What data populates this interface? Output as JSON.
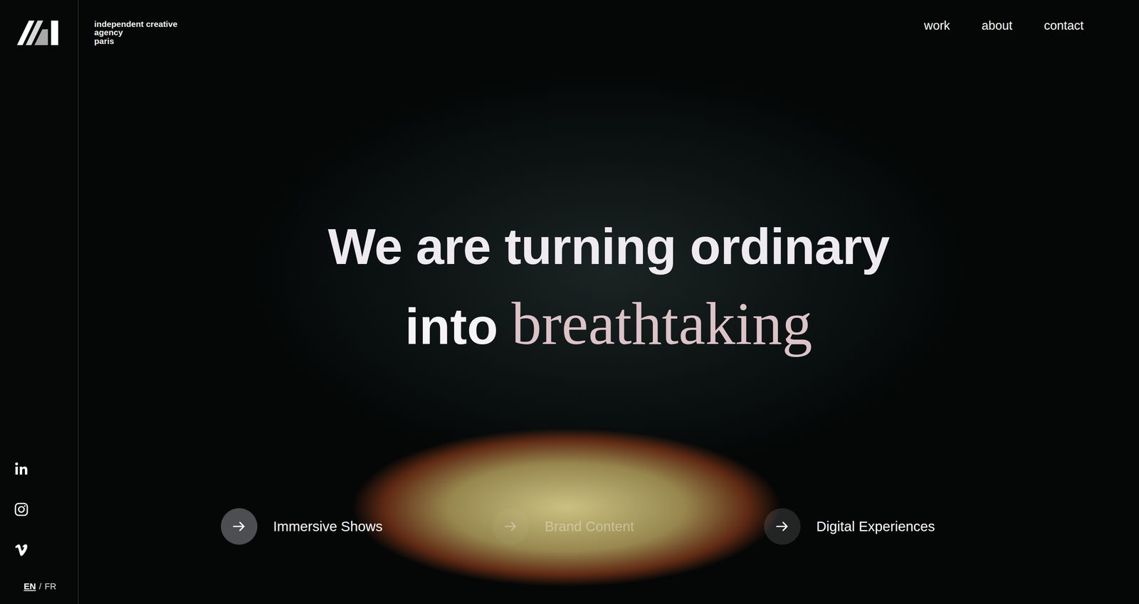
{
  "brand": {
    "tagline": [
      "independent creative",
      "agency",
      "paris"
    ]
  },
  "nav": [
    {
      "label": "work"
    },
    {
      "label": "about"
    },
    {
      "label": "contact"
    }
  ],
  "hero": {
    "line1": "We are turning ordinary",
    "line2_prefix": "into",
    "highlight": "breathtaking"
  },
  "services": [
    {
      "label": "Immersive Shows",
      "selected": true,
      "dimmed": false
    },
    {
      "label": "Brand Content",
      "selected": false,
      "dimmed": true
    },
    {
      "label": "Digital Experiences",
      "selected": false,
      "dimmed": false
    }
  ],
  "socials": [
    {
      "kind": "linkedin"
    },
    {
      "kind": "instagram"
    },
    {
      "kind": "vimeo"
    }
  ],
  "languages": [
    {
      "label": "EN",
      "selected": true
    },
    {
      "label": "FR",
      "selected": false
    }
  ],
  "language_separator": "/"
}
